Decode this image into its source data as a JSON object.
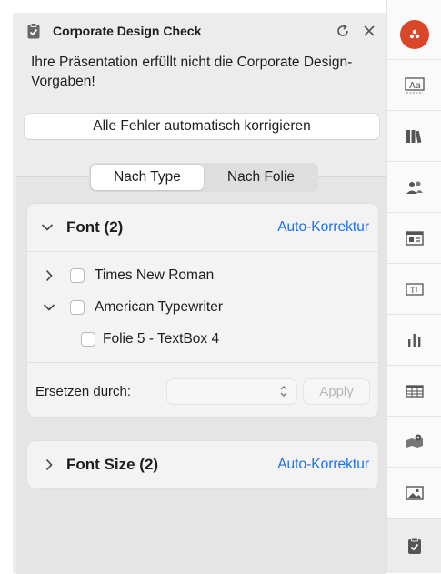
{
  "header": {
    "title": "Corporate Design Check",
    "icon": "clipboard-check-icon",
    "refresh_icon": "refresh-icon",
    "close_icon": "close-icon"
  },
  "message": "Ihre Präsentation erfüllt nicht die Corporate Design-Vorgaben!",
  "fix_all_label": "Alle Fehler automatisch korrigieren",
  "view_toggle": {
    "options": [
      "Nach Type",
      "Nach Folie"
    ],
    "selected": "Nach Type"
  },
  "sections": [
    {
      "title": "Font (2)",
      "expanded": true,
      "auto_fix_label": "Auto-Korrektur",
      "items": [
        {
          "label": "Times New Roman",
          "expanded": false,
          "checked": false
        },
        {
          "label": "American Typewriter",
          "expanded": true,
          "checked": false,
          "children": [
            {
              "label": "Folie 5 - TextBox 4",
              "checked": false
            }
          ]
        }
      ],
      "replace": {
        "label": "Ersetzen durch:",
        "value": "",
        "apply_label": "Apply"
      }
    },
    {
      "title": "Font Size (2)",
      "expanded": false,
      "auto_fix_label": "Auto-Korrektur"
    }
  ],
  "rail": {
    "items": [
      "brand-logo-icon",
      "font-style-icon",
      "library-icon",
      "people-icon",
      "layout-icon",
      "textbox-icon",
      "chart-icon",
      "table-icon",
      "map-pin-icon",
      "image-icon",
      "clipboard-check-icon"
    ],
    "active": "clipboard-check-icon"
  },
  "colors": {
    "accent_link": "#1a6ff2",
    "brand": "#d9472b",
    "panel_bg": "#ececec"
  }
}
